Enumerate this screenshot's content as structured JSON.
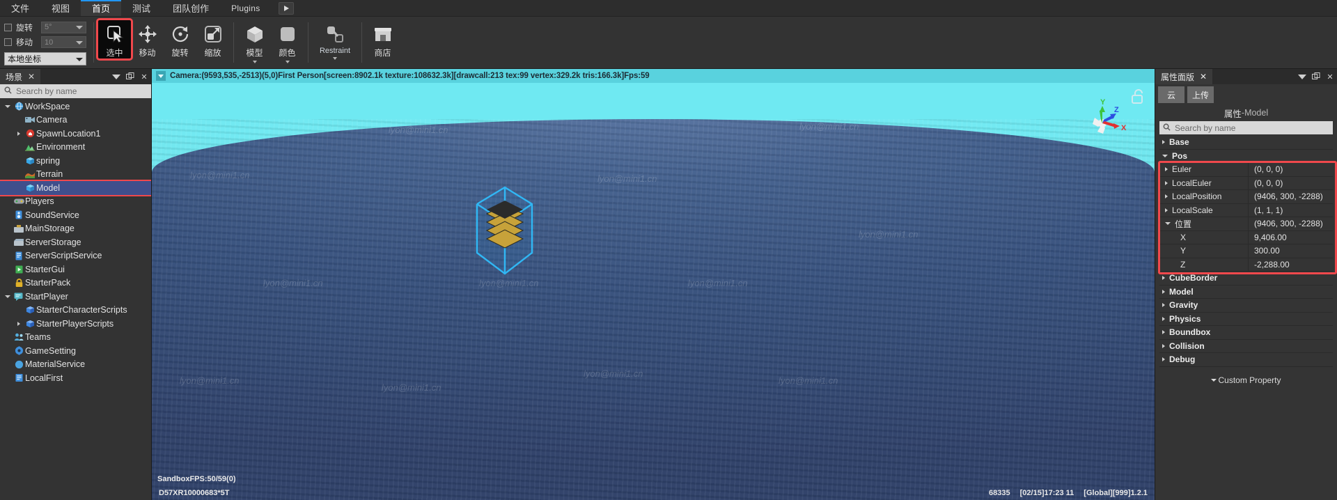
{
  "menubar": {
    "items": [
      {
        "label": "文件",
        "active": false
      },
      {
        "label": "视图",
        "active": false
      },
      {
        "label": "首页",
        "active": true
      },
      {
        "label": "测试",
        "active": false
      },
      {
        "label": "团队创作",
        "active": false
      },
      {
        "label": "Plugins",
        "active": false
      }
    ],
    "play_icon": "play-icon"
  },
  "toolbar": {
    "snap": {
      "rotate_label": "旋转",
      "rotate_value": "5°",
      "move_label": "移动",
      "move_value": "10",
      "coord_value": "本地坐标"
    },
    "tools": [
      {
        "label": "选中",
        "icon": "cursor-select-icon",
        "selected": true
      },
      {
        "label": "移动",
        "icon": "move-arrows-icon",
        "selected": false
      },
      {
        "label": "旋转",
        "icon": "rotate-circle-icon",
        "selected": false
      },
      {
        "label": "缩放",
        "icon": "scale-arrow-icon",
        "selected": false
      }
    ],
    "inserts": [
      {
        "label": "模型",
        "icon": "cube-icon",
        "caret": true
      },
      {
        "label": "颜色",
        "icon": "color-swatch-icon",
        "caret": true
      }
    ],
    "constraint": {
      "label": "Restraint",
      "icon": "constraint-link-icon",
      "caret": true
    },
    "store": {
      "label": "商店",
      "icon": "store-icon"
    }
  },
  "explorer": {
    "tab_label": "场景",
    "close_icon": "close-icon",
    "menu_icon": "chevron-down-icon",
    "float_icon": "float-window-icon",
    "panel_close_icon": "close-icon",
    "search_placeholder": "Search by name",
    "search_icon": "search-icon",
    "tree": [
      {
        "label": "WorkSpace",
        "depth": 0,
        "arrow": "open",
        "icon": "globe-icon",
        "color": "#4aa3e0",
        "selected": false
      },
      {
        "label": "Camera",
        "depth": 1,
        "arrow": "none",
        "icon": "camera-icon",
        "color": "#8fb4c8",
        "selected": false
      },
      {
        "label": "SpawnLocation1",
        "depth": 1,
        "arrow": "closed",
        "icon": "spawn-pin-icon",
        "color": "#d8392e",
        "selected": false
      },
      {
        "label": "Environment",
        "depth": 1,
        "arrow": "none",
        "icon": "environment-icon",
        "color": "#4fbf6a",
        "selected": false
      },
      {
        "label": "spring",
        "depth": 1,
        "arrow": "none",
        "icon": "part-cube-icon",
        "color": "#38a8e8",
        "selected": false
      },
      {
        "label": "Terrain",
        "depth": 1,
        "arrow": "none",
        "icon": "terrain-icon",
        "color": "#cd6b2a",
        "selected": false
      },
      {
        "label": "Model",
        "depth": 1,
        "arrow": "none",
        "icon": "part-cube-icon",
        "color": "#38a8e8",
        "selected": true
      },
      {
        "label": "Players",
        "depth": 0,
        "arrow": "none",
        "icon": "gamepad-icon",
        "color": "#9aa0a6",
        "selected": false
      },
      {
        "label": "SoundService",
        "depth": 0,
        "arrow": "none",
        "icon": "speaker-icon",
        "color": "#3f8fdc",
        "selected": false
      },
      {
        "label": "MainStorage",
        "depth": 0,
        "arrow": "none",
        "icon": "storage-box-icon",
        "color": "#c8a13b",
        "selected": false
      },
      {
        "label": "ServerStorage",
        "depth": 0,
        "arrow": "none",
        "icon": "server-box-icon",
        "color": "#9fb4c4",
        "selected": false
      },
      {
        "label": "ServerScriptService",
        "depth": 0,
        "arrow": "none",
        "icon": "script-server-icon",
        "color": "#3f8fdc",
        "selected": false
      },
      {
        "label": "StarterGui",
        "depth": 0,
        "arrow": "none",
        "icon": "gui-play-icon",
        "color": "#3fae52",
        "selected": false
      },
      {
        "label": "StarterPack",
        "depth": 0,
        "arrow": "none",
        "icon": "lock-icon",
        "color": "#e0b128",
        "selected": false
      },
      {
        "label": "StartPlayer",
        "depth": 0,
        "arrow": "open",
        "icon": "player-chat-icon",
        "color": "#56b8c9",
        "selected": false
      },
      {
        "label": "StarterCharacterScripts",
        "depth": 1,
        "arrow": "none",
        "icon": "blue-cube-icon",
        "color": "#3d86e0",
        "selected": false
      },
      {
        "label": "StarterPlayerScripts",
        "depth": 1,
        "arrow": "closed",
        "icon": "blue-cube-icon",
        "color": "#3d86e0",
        "selected": false
      },
      {
        "label": "Teams",
        "depth": 0,
        "arrow": "none",
        "icon": "teams-icon",
        "color": "#54aede",
        "selected": false
      },
      {
        "label": "GameSetting",
        "depth": 0,
        "arrow": "none",
        "icon": "settings-gear-icon",
        "color": "#3f8fdc",
        "selected": false
      },
      {
        "label": "MaterialService",
        "depth": 0,
        "arrow": "none",
        "icon": "material-icon",
        "color": "#4aa3e0",
        "selected": false
      },
      {
        "label": "LocalFirst",
        "depth": 0,
        "arrow": "none",
        "icon": "local-first-icon",
        "color": "#3f8fdc",
        "selected": false
      }
    ]
  },
  "viewport": {
    "status_text": "Camera:(9593,535,-2513)(5,0)First Person[screen:8902.1k texture:108632.3k][drawcall:213 tex:99 vertex:329.2k tris:166.3k]Fps:59",
    "expand_icon": "chevron-down-icon",
    "lock_icon": "unlock-icon",
    "gizmo_axes": [
      "X",
      "Y",
      "Z"
    ],
    "fps_text": "SandboxFPS:50/59(0)",
    "bottom_left": "D57XR10000683*5T",
    "bottom_right": [
      "68335",
      "[02/15]17:23 11",
      "[Global][999]1.2.1"
    ],
    "watermark_text": "lyon@mini1.cn"
  },
  "properties": {
    "tab_label": "属性面版",
    "close_icon": "close-icon",
    "menu_icon": "chevron-down-icon",
    "float_icon": "float-window-icon",
    "panel_close_icon": "close-icon",
    "buttons": [
      {
        "label": "云"
      },
      {
        "label": "上传"
      }
    ],
    "title_prefix": "属性",
    "title_sep": " - ",
    "title_target": "Model",
    "search_placeholder": "Search by name",
    "search_icon": "search-icon",
    "categories": [
      {
        "label": "Base",
        "open": false
      },
      {
        "label": "Pos",
        "open": true
      }
    ],
    "rows": [
      {
        "key": "Euler",
        "value": "(0, 0, 0)",
        "expand": "closed",
        "sub": false
      },
      {
        "key": "LocalEuler",
        "value": "(0, 0, 0)",
        "expand": "closed",
        "sub": false
      },
      {
        "key": "LocalPosition",
        "value": "(9406, 300, -2288)",
        "expand": "closed",
        "sub": false
      },
      {
        "key": "LocalScale",
        "value": "(1, 1, 1)",
        "expand": "closed",
        "sub": false
      },
      {
        "key": "位置",
        "value": "(9406, 300, -2288)",
        "expand": "open",
        "sub": false
      },
      {
        "key": "X",
        "value": "9,406.00",
        "expand": "none",
        "sub": true
      },
      {
        "key": "Y",
        "value": "300.00",
        "expand": "none",
        "sub": true
      },
      {
        "key": "Z",
        "value": "-2,288.00",
        "expand": "none",
        "sub": true
      }
    ],
    "tail_categories": [
      {
        "label": "CubeBorder",
        "open": false
      },
      {
        "label": "Model",
        "open": false
      },
      {
        "label": "Gravity",
        "open": false
      },
      {
        "label": "Physics",
        "open": false
      },
      {
        "label": "Boundbox",
        "open": false
      },
      {
        "label": "Collision",
        "open": false
      },
      {
        "label": "Debug",
        "open": false
      }
    ],
    "custom_property_label": "Custom Property"
  },
  "colors": {
    "accent_highlight": "#f0484c",
    "selection_blue": "#3f4f8c",
    "tab_active_blue": "#2196f3",
    "sky": "#6fe9f2",
    "ground": "#3c5580"
  }
}
